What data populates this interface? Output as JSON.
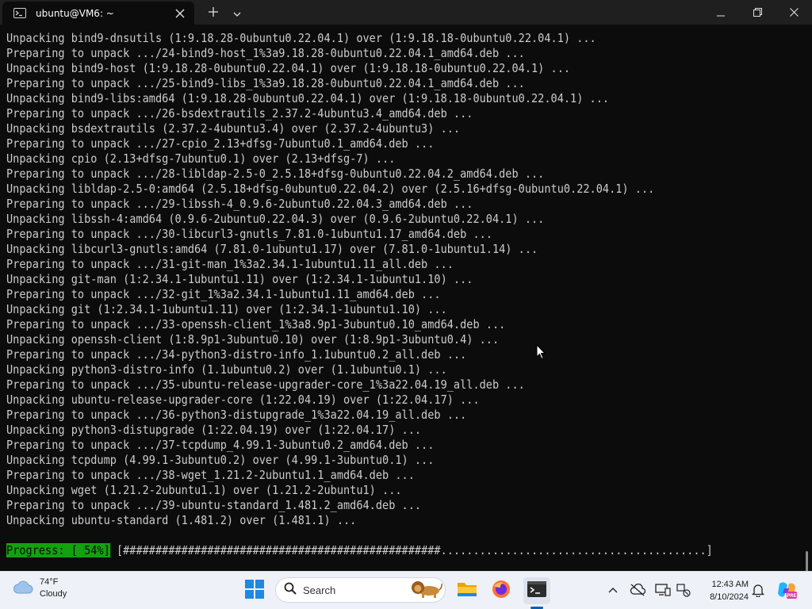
{
  "window": {
    "tab_title": "ubuntu@VM6: ~",
    "tab_icon": "terminal-icon",
    "new_tab_icon": "plus-icon",
    "dropdown_icon": "chevron-down-icon",
    "minimize_icon": "minimize-icon",
    "maximize_icon": "maximize-icon",
    "close_icon": "close-icon"
  },
  "terminal": {
    "lines": [
      "Unpacking bind9-dnsutils (1:9.18.28-0ubuntu0.22.04.1) over (1:9.18.18-0ubuntu0.22.04.1) ...",
      "Preparing to unpack .../24-bind9-host_1%3a9.18.28-0ubuntu0.22.04.1_amd64.deb ...",
      "Unpacking bind9-host (1:9.18.28-0ubuntu0.22.04.1) over (1:9.18.18-0ubuntu0.22.04.1) ...",
      "Preparing to unpack .../25-bind9-libs_1%3a9.18.28-0ubuntu0.22.04.1_amd64.deb ...",
      "Unpacking bind9-libs:amd64 (1:9.18.28-0ubuntu0.22.04.1) over (1:9.18.18-0ubuntu0.22.04.1) ...",
      "Preparing to unpack .../26-bsdextrautils_2.37.2-4ubuntu3.4_amd64.deb ...",
      "Unpacking bsdextrautils (2.37.2-4ubuntu3.4) over (2.37.2-4ubuntu3) ...",
      "Preparing to unpack .../27-cpio_2.13+dfsg-7ubuntu0.1_amd64.deb ...",
      "Unpacking cpio (2.13+dfsg-7ubuntu0.1) over (2.13+dfsg-7) ...",
      "Preparing to unpack .../28-libldap-2.5-0_2.5.18+dfsg-0ubuntu0.22.04.2_amd64.deb ...",
      "Unpacking libldap-2.5-0:amd64 (2.5.18+dfsg-0ubuntu0.22.04.2) over (2.5.16+dfsg-0ubuntu0.22.04.1) ...",
      "Preparing to unpack .../29-libssh-4_0.9.6-2ubuntu0.22.04.3_amd64.deb ...",
      "Unpacking libssh-4:amd64 (0.9.6-2ubuntu0.22.04.3) over (0.9.6-2ubuntu0.22.04.1) ...",
      "Preparing to unpack .../30-libcurl3-gnutls_7.81.0-1ubuntu1.17_amd64.deb ...",
      "Unpacking libcurl3-gnutls:amd64 (7.81.0-1ubuntu1.17) over (7.81.0-1ubuntu1.14) ...",
      "Preparing to unpack .../31-git-man_1%3a2.34.1-1ubuntu1.11_all.deb ...",
      "Unpacking git-man (1:2.34.1-1ubuntu1.11) over (1:2.34.1-1ubuntu1.10) ...",
      "Preparing to unpack .../32-git_1%3a2.34.1-1ubuntu1.11_amd64.deb ...",
      "Unpacking git (1:2.34.1-1ubuntu1.11) over (1:2.34.1-1ubuntu1.10) ...",
      "Preparing to unpack .../33-openssh-client_1%3a8.9p1-3ubuntu0.10_amd64.deb ...",
      "Unpacking openssh-client (1:8.9p1-3ubuntu0.10) over (1:8.9p1-3ubuntu0.4) ...",
      "Preparing to unpack .../34-python3-distro-info_1.1ubuntu0.2_all.deb ...",
      "Unpacking python3-distro-info (1.1ubuntu0.2) over (1.1ubuntu0.1) ...",
      "Preparing to unpack .../35-ubuntu-release-upgrader-core_1%3a22.04.19_all.deb ...",
      "Unpacking ubuntu-release-upgrader-core (1:22.04.19) over (1:22.04.17) ...",
      "Preparing to unpack .../36-python3-distupgrade_1%3a22.04.19_all.deb ...",
      "Unpacking python3-distupgrade (1:22.04.19) over (1:22.04.17) ...",
      "Preparing to unpack .../37-tcpdump_4.99.1-3ubuntu0.2_amd64.deb ...",
      "Unpacking tcpdump (4.99.1-3ubuntu0.2) over (4.99.1-3ubuntu0.1) ...",
      "Preparing to unpack .../38-wget_1.21.2-2ubuntu1.1_amd64.deb ...",
      "Unpacking wget (1.21.2-2ubuntu1.1) over (1.21.2-2ubuntu1) ...",
      "Preparing to unpack .../39-ubuntu-standard_1.481.2_amd64.deb ...",
      "Unpacking ubuntu-standard (1.481.2) over (1.481.1) ..."
    ],
    "progress_label": "Progress: [ 54%]",
    "progress_bar": " [#################################################.........................................]",
    "progress_percent": 54,
    "text_color": "#cccccc",
    "progress_color": "#13a10e",
    "background": "#0c0c0c"
  },
  "taskbar": {
    "weather_temp": "74°F",
    "weather_condition": "Cloudy",
    "weather_icon": "cloud-icon",
    "search_placeholder": "Search",
    "apps": [
      "windows-start-icon",
      "search-icon",
      "file-explorer-icon",
      "firefox-icon",
      "terminal-icon"
    ],
    "tray": [
      "chevron-up-icon",
      "onedrive-offline-icon",
      "display-icon",
      "network-icon",
      "notification-bell-icon",
      "copilot-icon"
    ],
    "time": "12:43 AM",
    "date": "8/10/2024"
  }
}
